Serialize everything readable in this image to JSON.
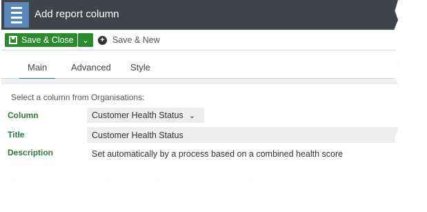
{
  "window": {
    "title": "Add report column"
  },
  "toolbar": {
    "save_close_label": "Save & Close",
    "save_new_label": "Save & New"
  },
  "tabs": [
    {
      "label": "Main",
      "active": true
    },
    {
      "label": "Advanced",
      "active": false
    },
    {
      "label": "Style",
      "active": false
    }
  ],
  "form": {
    "hint": "Select a column from Organisations:",
    "column_label": "Column",
    "column_value": "Customer Health Status",
    "title_label": "Title",
    "title_value": "Customer Health Status",
    "description_label": "Description",
    "description_value": "Set automatically by a process based on a combined health score"
  },
  "colors": {
    "header": "#3f444a",
    "menu": "#5b86b8",
    "primary": "#2c8a2e",
    "label": "#2b7a3a",
    "tab_accent": "#2c6fb0"
  },
  "icons": [
    "menu-icon",
    "save-icon",
    "chevron-down-icon",
    "plus-circle-icon"
  ]
}
